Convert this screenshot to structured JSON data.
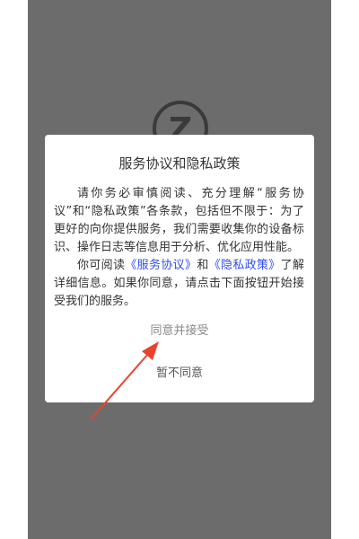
{
  "background": {
    "logo_letter": "Z"
  },
  "dialog": {
    "title": "服务协议和隐私政策",
    "paragraph1": "请你务必审慎阅读、充分理解“服务协议”和“隐私政策”各条款，包括但不限于：为了更好的向你提供服务，我们需要收集你的设备标识、操作日志等信息用于分析、优化应用性能。",
    "paragraph2_before": "你可阅读",
    "service_agreement_link": "《服务协议》",
    "paragraph2_and": "和",
    "privacy_policy_link": "《隐私政策》",
    "paragraph2_after": "了解详细信息。如果你同意，请点击下面按钮开始接受我们的服务。",
    "agree_label": "同意并接受",
    "decline_label": "暂不同意"
  },
  "colors": {
    "overlay": "#6c6c6c",
    "link": "#2f4ee8",
    "annotation_arrow": "#e8442d"
  }
}
